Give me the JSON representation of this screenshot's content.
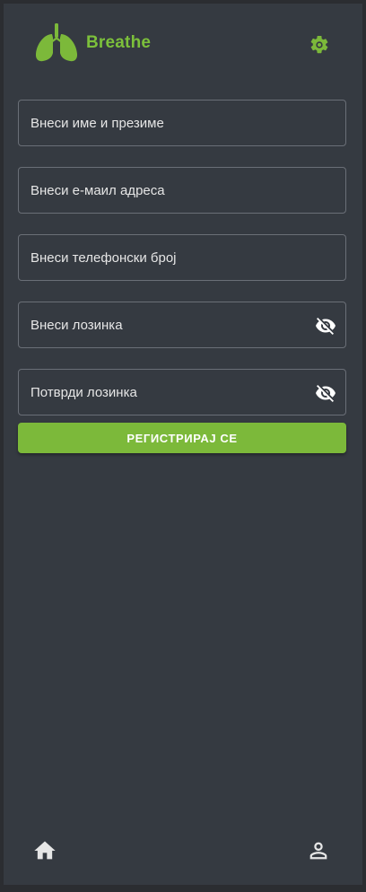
{
  "app": {
    "brand": "Breathe",
    "logo_icon": "lungs-icon",
    "settings_icon": "gear-icon",
    "accent_color": "#7cb93a"
  },
  "form": {
    "full_name": {
      "placeholder": "Внеси име и презиме",
      "value": ""
    },
    "email": {
      "placeholder": "Внеси е-маил адреса",
      "value": ""
    },
    "phone": {
      "placeholder": "Внеси телефонски број",
      "value": ""
    },
    "password": {
      "placeholder": "Внеси лозинка",
      "value": "",
      "toggle_icon": "eye-off-icon"
    },
    "confirm_password": {
      "placeholder": "Потврди лозинка",
      "value": "",
      "toggle_icon": "eye-off-icon"
    },
    "submit_label": "РЕГИСТРИРАЈ СЕ"
  },
  "bottom_nav": {
    "home_icon": "home-icon",
    "profile_icon": "person-icon"
  }
}
